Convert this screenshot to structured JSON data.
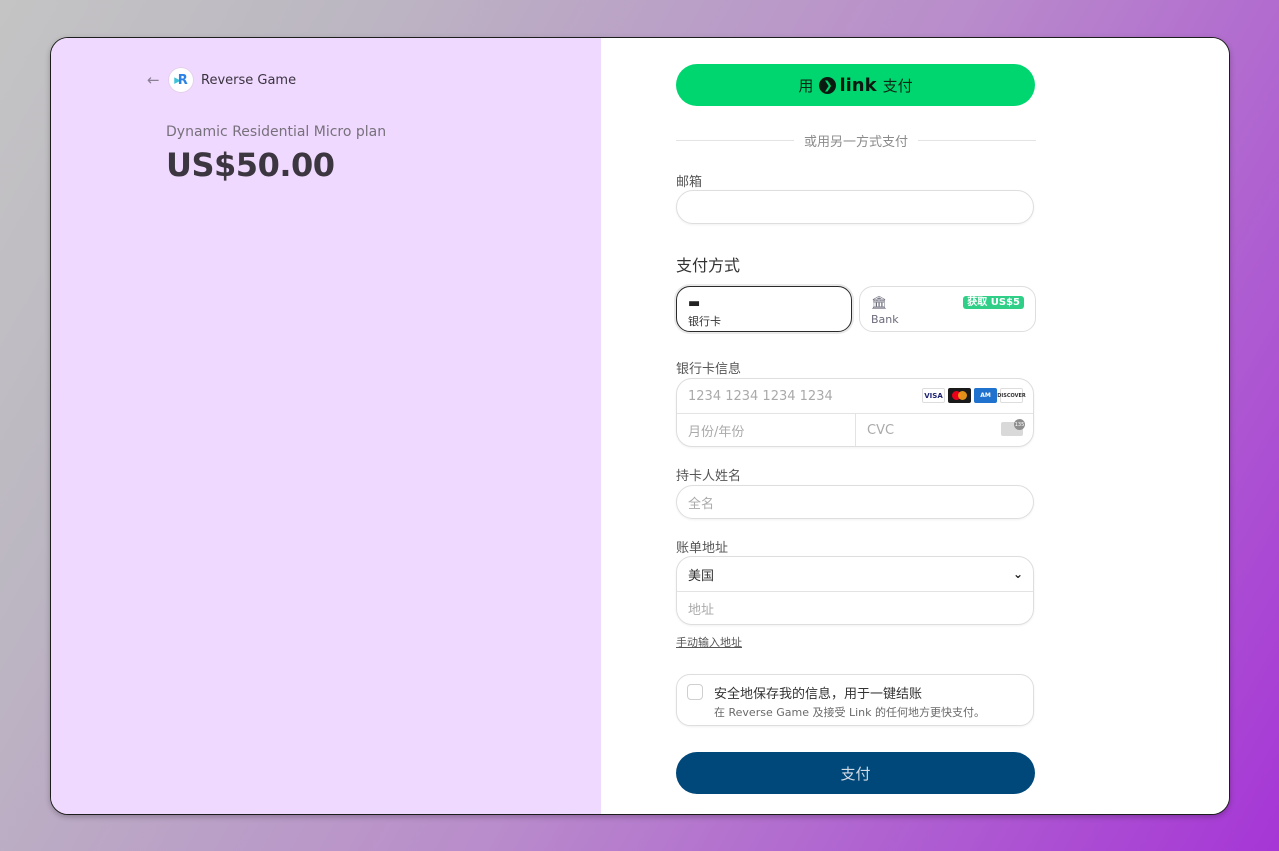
{
  "merchant": {
    "name": "Reverse Game",
    "logo_text": "R"
  },
  "order": {
    "plan": "Dynamic Residential Micro plan",
    "price": "US$50.00"
  },
  "link_button": {
    "prefix": "用",
    "brand": "link",
    "suffix": "支付"
  },
  "divider_text": "或用另一方式支付",
  "email": {
    "label": "邮箱",
    "value": ""
  },
  "payment_method": {
    "title": "支付方式",
    "options": [
      {
        "label": "银行卡",
        "selected": true
      },
      {
        "label": "Bank",
        "promo": "获取 US$5",
        "selected": false
      }
    ]
  },
  "card": {
    "label": "银行卡信息",
    "number_placeholder": "1234 1234 1234 1234",
    "expiry_placeholder": "月份/年份",
    "cvc_placeholder": "CVC",
    "brands": [
      "VISA",
      "Mastercard",
      "AMEX",
      "DISCOVER"
    ]
  },
  "cardholder": {
    "label": "持卡人姓名",
    "placeholder": "全名"
  },
  "billing": {
    "label": "账单地址",
    "country": "美国",
    "address_placeholder": "地址",
    "manual_link": "手动输入地址"
  },
  "save_info": {
    "title": "安全地保存我的信息，用于一键结账",
    "subtitle": "在 Reverse Game 及接受 Link 的任何地方更快支付。"
  },
  "pay_button": {
    "label": "支付"
  },
  "colors": {
    "link_green": "#00d66f",
    "pay_blue": "#00487a",
    "left_panel": "#f0d9ff"
  }
}
